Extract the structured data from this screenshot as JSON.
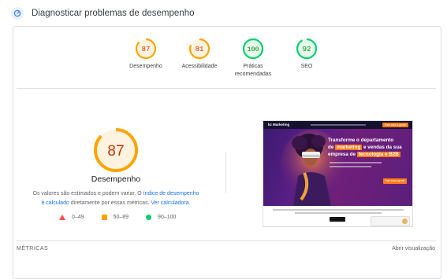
{
  "header": {
    "title": "Diagnosticar problemas de desempenho",
    "icon": "speed-icon"
  },
  "scores": [
    {
      "value": "87",
      "label": "Desempenho",
      "color": "#ffa400",
      "fraction": 0.87
    },
    {
      "value": "81",
      "label": "Acessibilidade",
      "color": "#ffa400",
      "fraction": 0.81
    },
    {
      "value": "100",
      "label_line1": "Práticas",
      "label_line2": "recomendadas",
      "color": "#0cce6b",
      "fraction": 1.0
    },
    {
      "value": "92",
      "label": "SEO",
      "color": "#0cce6b",
      "fraction": 0.92
    }
  ],
  "main_score": {
    "value": "87",
    "title": "Desempenho",
    "color": "#ffa400",
    "fraction": 0.87
  },
  "description": {
    "part1": "Os valores são estimados e podem variar. O ",
    "link1": "índice de desempenho é calculado",
    "part2": " diretamente por essas métricas. ",
    "link2": "Ver calculadora."
  },
  "legend": [
    {
      "range": "0–49",
      "shape": "triangle",
      "color": "#ff4e42"
    },
    {
      "range": "50–89",
      "shape": "square",
      "color": "#ffa400"
    },
    {
      "range": "90–100",
      "shape": "circle",
      "color": "#0cce6b"
    }
  ],
  "screenshot": {
    "logo_text": "kz Marketing",
    "nav_cta": "Fale com a gente",
    "headline_line1": "Transforme o departamento",
    "headline_line2_a": "de",
    "headline_line2_hl": "marketing",
    "headline_line2_b": "e vendas da sua",
    "headline_line3_a": "empresa de",
    "headline_line3_hl": "tecnologia e B2B",
    "cta": "Fale com a gente"
  },
  "footer": {
    "metrics_label": "MÉTRICAS",
    "expand_label": "Abrir visualização"
  }
}
